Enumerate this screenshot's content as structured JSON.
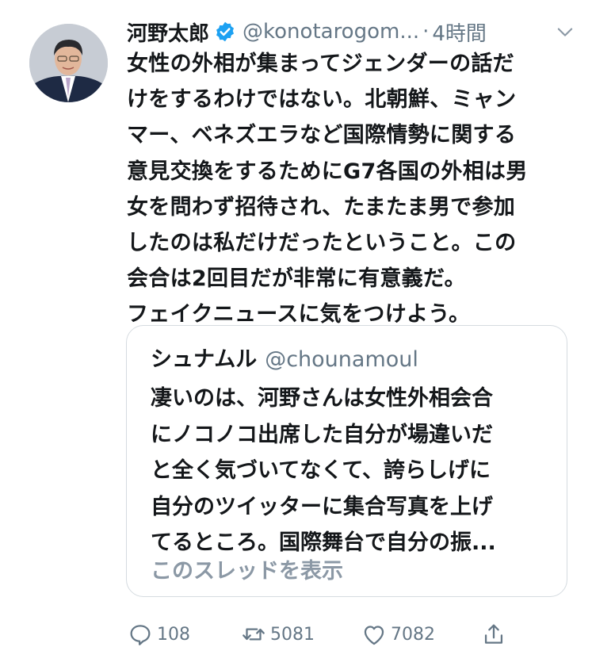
{
  "tweet": {
    "author_name": "河野太郎",
    "handle": "@konotarogom...",
    "separator": "·",
    "time": "4時間",
    "text_lines": [
      "女性の外相が集まってジェンダーの話だ",
      "けをするわけではない。北朝鮮、ミャン",
      "マー、ベネズエラなど国際情勢に関する",
      "意見交換をするためにG7各国の外相は男",
      "女を問わず招待され、たまたま男で参加",
      "したのは私だけだったということ。この",
      "会合は2回目だが非常に有意義だ。",
      "フェイクニュースに気をつけよう。"
    ]
  },
  "quote": {
    "author_name": "シュナムル",
    "handle": "@chounamoul",
    "text_lines": [
      "凄いのは、河野さんは女性外相会合",
      "にノコノコ出席した自分が場違いだ",
      "と全く気づいてなくて、誇らしげに",
      "自分のツイッターに集合写真を上げ",
      "てるところ。国際舞台で自分の振..."
    ],
    "show_thread": "このスレッドを表示"
  },
  "actions": {
    "replies": "108",
    "retweets": "5081",
    "likes": "7082"
  },
  "icons": [
    "verified-badge-icon",
    "chevron-down-icon",
    "reply-icon",
    "retweet-icon",
    "like-icon",
    "share-icon"
  ],
  "colors": {
    "verified": "#1da1f2",
    "secondary_text": "#657786",
    "link_gray": "#8b98a5",
    "border": "#d5dbe0"
  }
}
